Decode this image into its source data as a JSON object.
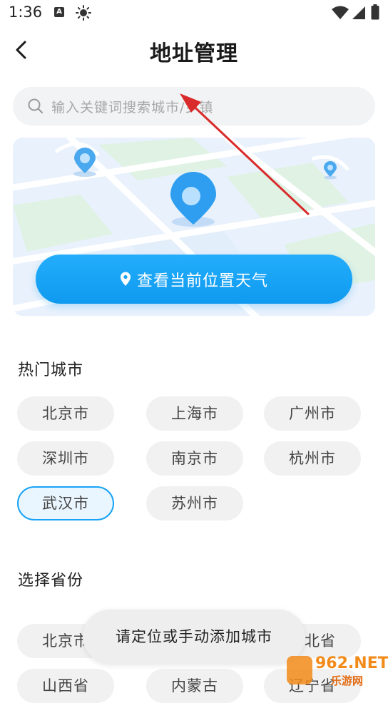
{
  "status_bar": {
    "time": "1:36",
    "notification_letter": "A"
  },
  "header": {
    "title": "地址管理"
  },
  "search": {
    "placeholder": "输入关键词搜索城市/乡镇"
  },
  "map_card": {
    "locate_button_label": "查看当前位置天气"
  },
  "hot_cities": {
    "title": "热门城市",
    "items": [
      {
        "label": "北京市",
        "selected": false
      },
      {
        "label": "上海市",
        "selected": false
      },
      {
        "label": "广州市",
        "selected": false
      },
      {
        "label": "深圳市",
        "selected": false
      },
      {
        "label": "南京市",
        "selected": false
      },
      {
        "label": "杭州市",
        "selected": false
      },
      {
        "label": "武汉市",
        "selected": true
      },
      {
        "label": "苏州市",
        "selected": false
      }
    ]
  },
  "provinces": {
    "title": "选择省份",
    "items": [
      {
        "label": "北京市"
      },
      {
        "label": "河北省"
      },
      {
        "label": "山西省"
      },
      {
        "label": "内蒙古"
      },
      {
        "label": "辽宁省"
      }
    ]
  },
  "toast": {
    "message": "请定位或手动添加城市"
  },
  "watermark": {
    "brand": "962.NET",
    "subtitle": "乐游网"
  },
  "colors": {
    "accent": "#19a3f5",
    "chip_bg": "#f1f1f1",
    "annotation_arrow": "#d92b2b"
  }
}
